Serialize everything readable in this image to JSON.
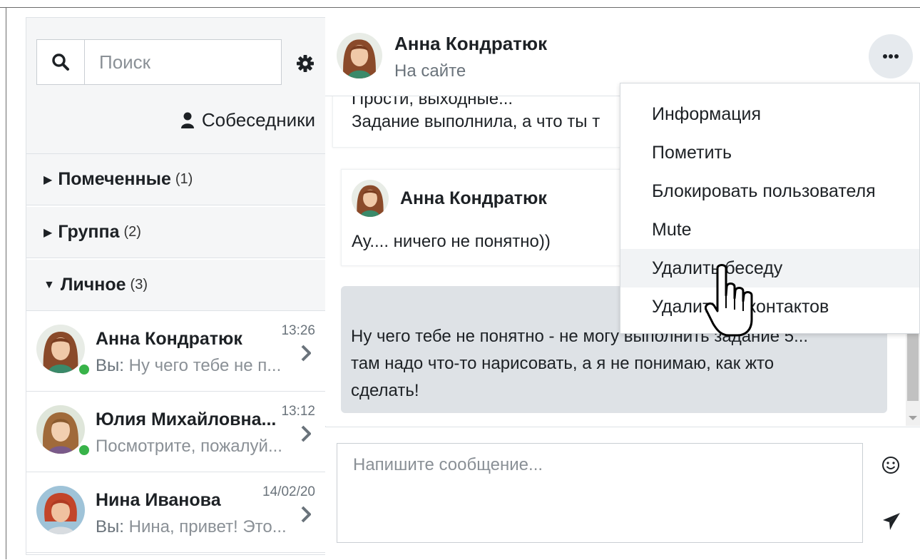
{
  "sidebar": {
    "search_placeholder": "Поиск",
    "contacts_label": "Собеседники",
    "sections": [
      {
        "label": "Помеченные",
        "count": "(1)",
        "expanded": false
      },
      {
        "label": "Группа",
        "count": "(2)",
        "expanded": false
      },
      {
        "label": "Личное",
        "count": "(3)",
        "expanded": true
      }
    ],
    "conversations": [
      {
        "name": "Анна Кондратюк",
        "time": "13:26",
        "you_prefix": "Вы:",
        "preview": " Ну чего тебе не п...",
        "online": true
      },
      {
        "name": "Юлия Михайловна...",
        "time": "13:12",
        "you_prefix": "",
        "preview": "Посмотрите, пожалуй...",
        "online": true
      },
      {
        "name": "Нина Иванова",
        "time": "14/02/20",
        "you_prefix": "Вы:",
        "preview": " Нина, привет! Это...",
        "online": false
      }
    ]
  },
  "chat": {
    "name": "Анна Кондратюк",
    "status": "На сайте",
    "messages": {
      "first_line": "Прости, выходные...",
      "second_line": "Задание выполнила, а что ты т",
      "second_sender": "Анна Кондратюк",
      "second_text": "Ау.... ничего не понятно))",
      "own_line1": "Ну чего тебе не понятно - не могу выполнить задание 5...",
      "own_line2": "там надо что-то нарисовать, а я не понимаю, как жто",
      "own_line3": "сделать!"
    },
    "composer_placeholder": "Напишите сообщение..."
  },
  "menu": {
    "items": [
      "Информация",
      "Пометить",
      "Блокировать пользователя",
      "Mute",
      "Удалить беседу",
      "Удалить из контактов"
    ],
    "highlighted_index": 4
  },
  "colors": {
    "online": "#38b349",
    "own_bubble": "#dee2e6",
    "panel": "#f5f6f7"
  }
}
